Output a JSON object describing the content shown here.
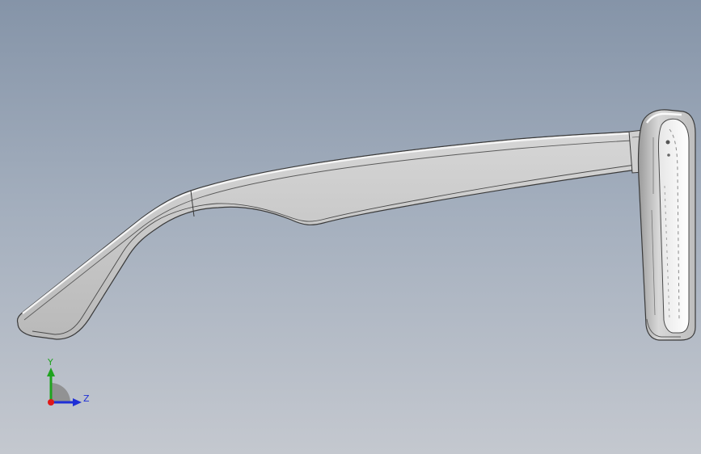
{
  "viewport": {
    "background_top": "#8594a8",
    "background_bottom": "#c4c8cf"
  },
  "model": {
    "part_color": "#c8c8c8",
    "edge_color": "#3a3a3a",
    "highlight_color": "#f2f2f2"
  },
  "triad": {
    "y_label": "Y",
    "z_label": "Z",
    "y_color": "#1fa31f",
    "z_color": "#1f2fd6",
    "x_color": "#e01818"
  }
}
